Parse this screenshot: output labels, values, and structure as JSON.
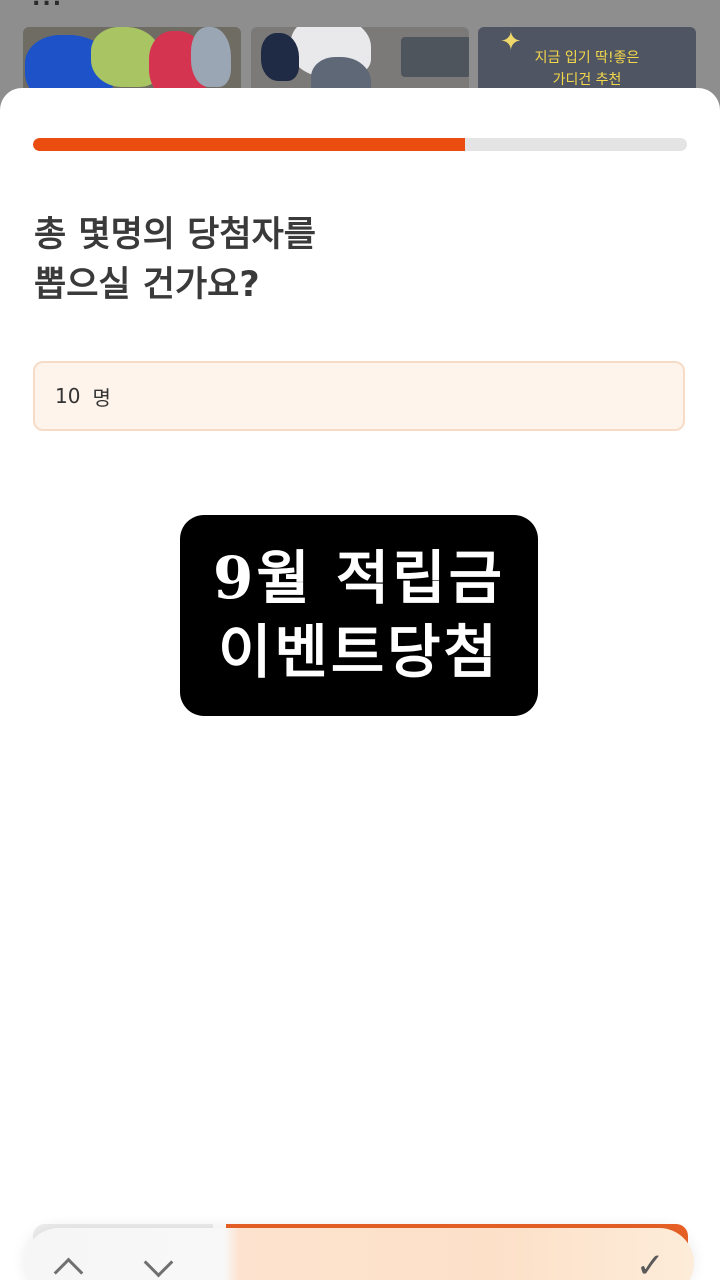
{
  "background": {
    "section_title": "...",
    "thumbnail_3_text_line1": "지금 입기 딱!좋은",
    "thumbnail_3_text_line2": "가디건 추천"
  },
  "progress": {
    "value_percent": 66,
    "color": "#ea4d0f"
  },
  "question": {
    "line1": "총 몇명의 당첨자를",
    "line2": "뽑으실 건가요?"
  },
  "winner_count_field": {
    "value": "10",
    "unit": "명"
  },
  "sticker": {
    "line1": "9월 적립금",
    "line2": "이벤트당첨"
  },
  "keyboard_toolbar": {
    "up_icon": "chevron-up-icon",
    "down_icon": "chevron-down-icon",
    "done_icon": "checkmark-icon"
  },
  "colors": {
    "accent": "#ea4d0f",
    "field_bg": "#fff4eb",
    "field_border": "#f6dcc6"
  }
}
